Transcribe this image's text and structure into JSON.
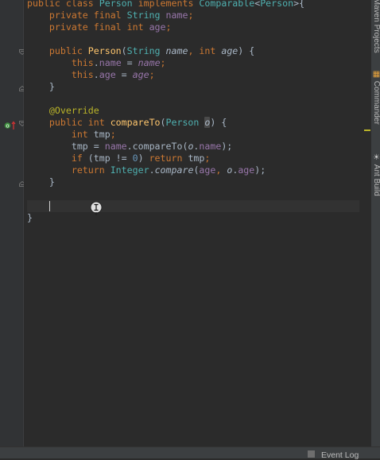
{
  "editor": {
    "lines": [
      [
        {
          "t": "public class ",
          "c": "kw"
        },
        {
          "t": "Person ",
          "c": "ty"
        },
        {
          "t": "implements ",
          "c": "kw"
        },
        {
          "t": "Comparable",
          "c": "ty"
        },
        {
          "t": "<",
          "c": ""
        },
        {
          "t": "Person",
          "c": "ty"
        },
        {
          "t": ">{",
          "c": ""
        }
      ],
      [
        {
          "t": "    private final ",
          "c": "kw"
        },
        {
          "t": "String ",
          "c": "ty"
        },
        {
          "t": "name",
          "c": "fd"
        },
        {
          "t": ";",
          "c": "kw"
        }
      ],
      [
        {
          "t": "    private final ",
          "c": "kw"
        },
        {
          "t": "int ",
          "c": "kw"
        },
        {
          "t": "age",
          "c": "fd"
        },
        {
          "t": ";",
          "c": "kw"
        }
      ],
      [],
      [
        {
          "t": "    public ",
          "c": "kw"
        },
        {
          "t": "Person",
          "c": "fn"
        },
        {
          "t": "(",
          "c": ""
        },
        {
          "t": "String ",
          "c": "ty"
        },
        {
          "t": "name",
          "c": "it"
        },
        {
          "t": ", ",
          "c": "kw"
        },
        {
          "t": "int ",
          "c": "kw"
        },
        {
          "t": "age",
          "c": "it"
        },
        {
          "t": ") {",
          "c": ""
        }
      ],
      [
        {
          "t": "        this",
          "c": "kw"
        },
        {
          "t": ".",
          "c": ""
        },
        {
          "t": "name",
          "c": "fd"
        },
        {
          "t": " = ",
          "c": ""
        },
        {
          "t": "name",
          "c": "pm"
        },
        {
          "t": ";",
          "c": "kw"
        }
      ],
      [
        {
          "t": "        this",
          "c": "kw"
        },
        {
          "t": ".",
          "c": ""
        },
        {
          "t": "age",
          "c": "fd"
        },
        {
          "t": " = ",
          "c": ""
        },
        {
          "t": "age",
          "c": "pm"
        },
        {
          "t": ";",
          "c": "kw"
        }
      ],
      [
        {
          "t": "    }",
          "c": ""
        }
      ],
      [],
      [
        {
          "t": "    @Override",
          "c": "an"
        }
      ],
      [
        {
          "t": "    public ",
          "c": "kw"
        },
        {
          "t": "int ",
          "c": "kw"
        },
        {
          "t": "compareTo",
          "c": "fn"
        },
        {
          "t": "(",
          "c": ""
        },
        {
          "t": "Person ",
          "c": "ty"
        },
        {
          "t": "o",
          "c": "it hl"
        },
        {
          "t": ") {",
          "c": ""
        }
      ],
      [
        {
          "t": "        int ",
          "c": "kw"
        },
        {
          "t": "tmp",
          "c": ""
        },
        {
          "t": ";",
          "c": "kw"
        }
      ],
      [
        {
          "t": "        tmp = ",
          "c": ""
        },
        {
          "t": "name",
          "c": "fd"
        },
        {
          "t": ".compareTo(",
          "c": ""
        },
        {
          "t": "o",
          "c": "it"
        },
        {
          "t": ".",
          "c": ""
        },
        {
          "t": "name",
          "c": "fd"
        },
        {
          "t": ");",
          "c": ""
        }
      ],
      [
        {
          "t": "        if ",
          "c": "kw"
        },
        {
          "t": "(tmp != ",
          "c": ""
        },
        {
          "t": "0",
          "c": "nm"
        },
        {
          "t": ") ",
          "c": ""
        },
        {
          "t": "return ",
          "c": "kw"
        },
        {
          "t": "tmp",
          "c": ""
        },
        {
          "t": ";",
          "c": "kw"
        }
      ],
      [
        {
          "t": "        return ",
          "c": "kw"
        },
        {
          "t": "Integer",
          "c": "ty"
        },
        {
          "t": ".",
          "c": ""
        },
        {
          "t": "compare",
          "c": "it"
        },
        {
          "t": "(",
          "c": ""
        },
        {
          "t": "age",
          "c": "fd"
        },
        {
          "t": ", ",
          "c": "kw"
        },
        {
          "t": "o",
          "c": "it"
        },
        {
          "t": ".",
          "c": ""
        },
        {
          "t": "age",
          "c": "fd"
        },
        {
          "t": ");",
          "c": ""
        }
      ],
      [
        {
          "t": "    }",
          "c": ""
        }
      ],
      [],
      [
        {
          "t": "    ",
          "c": ""
        },
        {
          "caret": true
        }
      ],
      [
        {
          "t": "}",
          "c": ""
        }
      ]
    ],
    "current_line_index": 17
  },
  "right_panel": {
    "tabs": [
      {
        "label": "Maven Projects",
        "icon": "maven-icon"
      },
      {
        "label": "Commander",
        "icon": "commander-icon"
      },
      {
        "label": "Ant Build",
        "icon": "ant-icon"
      }
    ]
  },
  "status_bar": {
    "event_log_label": "Event Log",
    "event_log_icon": "event-log-icon"
  },
  "gutter": {
    "icons": [
      "implemented-method-icon",
      "fold-icon"
    ]
  },
  "colors": {
    "background": "#2b2b2b",
    "keyword": "#cc7832",
    "type": "#4fb0b0",
    "field": "#9876aa",
    "method": "#ffc66d",
    "annotation": "#bbb529",
    "number": "#6897bb"
  }
}
